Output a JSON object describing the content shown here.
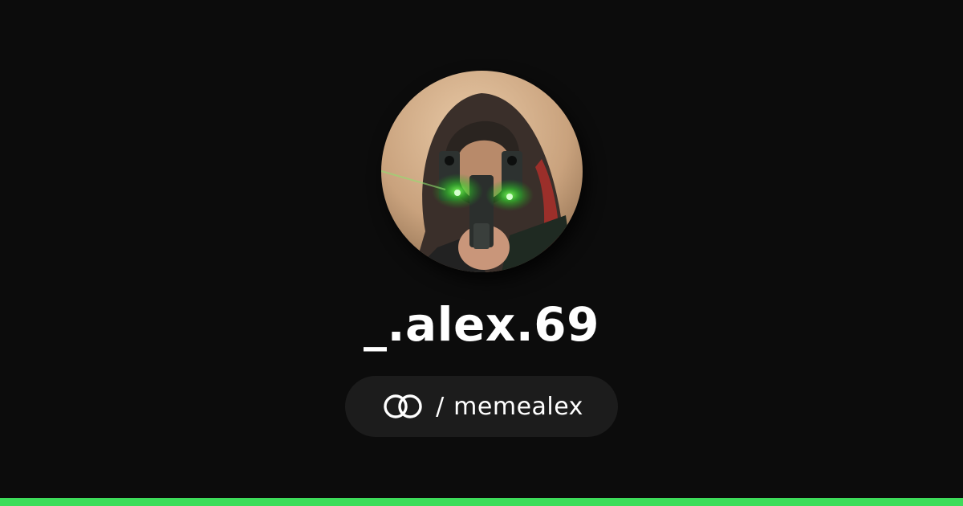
{
  "profile": {
    "display_name": "_.alex.69",
    "separator": "/",
    "handle": "memealex"
  },
  "icons": {
    "link": "interlocked-rings-icon",
    "avatar": "profile-photo"
  },
  "colors": {
    "background": "#0c0c0c",
    "pill_background": "#1c1c1c",
    "text": "#ffffff",
    "accent": "#3ddc5a"
  }
}
